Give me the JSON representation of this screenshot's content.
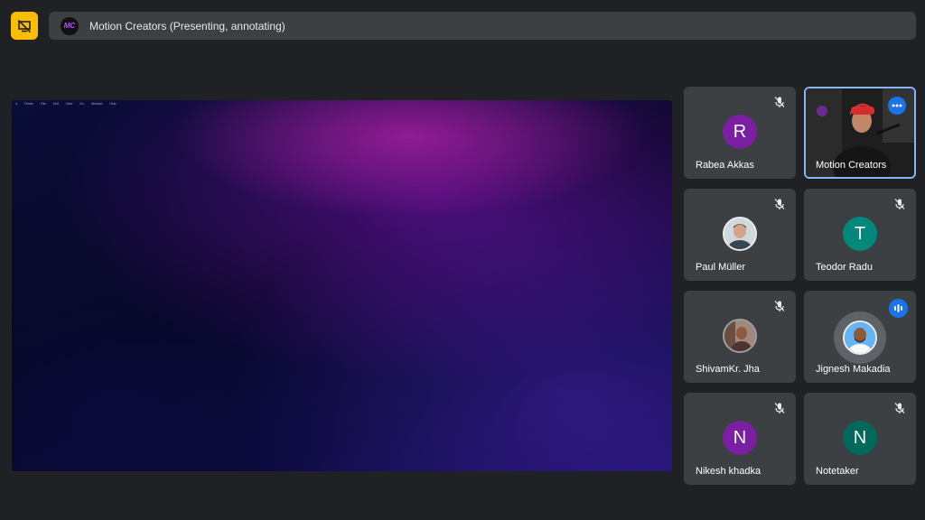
{
  "banner": {
    "logo_text": "MC",
    "title": "Motion Creators (Presenting, annotating)"
  },
  "presentation": {
    "menubar_items": [
      "Finder",
      "File",
      "Edit",
      "View",
      "Go",
      "Window",
      "Help"
    ]
  },
  "participants": [
    {
      "name": "Rabea Akkas",
      "initial": "R",
      "avatar_color": "#7b1fa2",
      "muted": true
    },
    {
      "name": "Motion Creators",
      "initial": "",
      "avatar_color": "",
      "muted": false,
      "video": true,
      "menu_icon": "more-horiz-icon"
    },
    {
      "name": "Paul Müller",
      "initial": "",
      "avatar_color": "#dadce0",
      "muted": true,
      "photo": true
    },
    {
      "name": "Teodor Radu",
      "initial": "T",
      "avatar_color": "#00897b",
      "muted": true
    },
    {
      "name": "ShivamKr. Jha",
      "initial": "",
      "avatar_color": "#8d6e63",
      "muted": true,
      "photo": true
    },
    {
      "name": "Jignesh Makadia",
      "initial": "",
      "avatar_color": "#4a90d9",
      "muted": false,
      "speaking": true,
      "photo": true
    },
    {
      "name": "Nikesh khadka",
      "initial": "N",
      "avatar_color": "#7b1fa2",
      "muted": true
    },
    {
      "name": "Notetaker",
      "initial": "N",
      "avatar_color": "#00695c",
      "muted": true
    }
  ],
  "colors": {
    "background": "#202124",
    "tile": "#3c4043",
    "present_button": "#fbbc04",
    "active_border": "#8ab4f8",
    "speaking_badge": "#1a73e8"
  }
}
